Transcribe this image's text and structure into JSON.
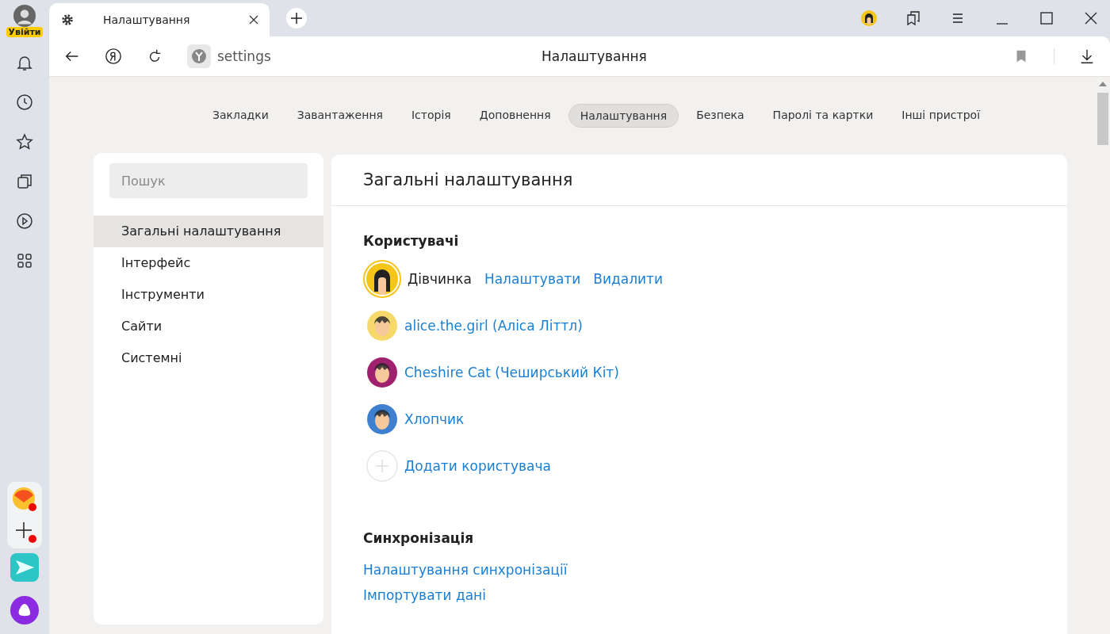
{
  "sidebar": {
    "login": "Увійти"
  },
  "tab": {
    "title": "Налаштування"
  },
  "address": {
    "url": "settings",
    "title": "Налаштування"
  },
  "nav_tabs": [
    {
      "label": "Закладки",
      "selected": false
    },
    {
      "label": "Завантаження",
      "selected": false
    },
    {
      "label": "Історія",
      "selected": false
    },
    {
      "label": "Доповнення",
      "selected": false
    },
    {
      "label": "Налаштування",
      "selected": true
    },
    {
      "label": "Безпека",
      "selected": false
    },
    {
      "label": "Паролі та картки",
      "selected": false
    },
    {
      "label": "Інші пристрої",
      "selected": false
    }
  ],
  "search": {
    "placeholder": "Пошук"
  },
  "menu": [
    {
      "label": "Загальні налаштування",
      "selected": true
    },
    {
      "label": "Інтерфейс",
      "selected": false
    },
    {
      "label": "Інструменти",
      "selected": false
    },
    {
      "label": "Сайти",
      "selected": false
    },
    {
      "label": "Системні",
      "selected": false
    }
  ],
  "panel": {
    "title": "Загальні налаштування",
    "users_heading": "Користувачі",
    "users": [
      {
        "kind": "current",
        "name": "Дівчинка",
        "color": "#f5c518",
        "actions": [
          "Налаштувати",
          "Видалити"
        ]
      },
      {
        "kind": "profile",
        "name": "alice.the.girl (Аліса Літтл)",
        "color": "#f7d96b"
      },
      {
        "kind": "profile",
        "name": "Cheshire Cat (Чеширський Кіт)",
        "color": "#a0226f"
      },
      {
        "kind": "profile",
        "name": "Хлопчик",
        "color": "#3f7fcf"
      },
      {
        "kind": "add",
        "name": "Додати користувача"
      }
    ],
    "sync_heading": "Синхронізація",
    "sync_links": [
      "Налаштування синхронізації",
      "Імпортувати дані"
    ]
  }
}
